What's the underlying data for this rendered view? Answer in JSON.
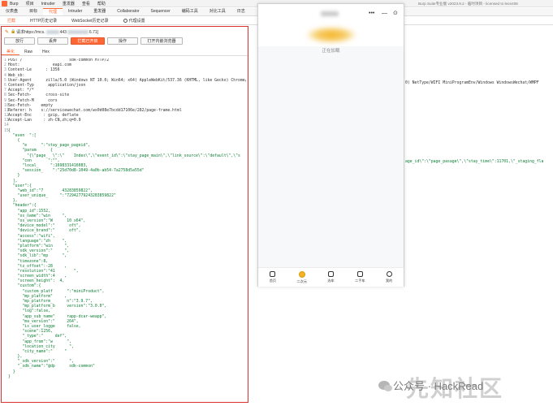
{
  "app": {
    "title": "Burp Suite专业版  v2023.9.2 - 临时项目 - licensed to leon406",
    "menu": [
      "Burp",
      "项目",
      "Intruder",
      "重发器",
      "查看",
      "帮助"
    ]
  },
  "tools": {
    "tabs": [
      "仪表盘",
      "目标",
      "代理",
      "Intruder",
      "重发器",
      "Collaborator",
      "Sequencer",
      "编码工具",
      "对比工具",
      "日志"
    ],
    "active_index": 2
  },
  "proxy_subtabs": {
    "tabs": [
      "拦截",
      "HTTP历史记录",
      "WebSocket历史记录",
      "代理设置"
    ],
    "active_index": 0
  },
  "intercept": {
    "request_prefix": "请求https://mcs.",
    "request_port": "443",
    "request_ip_tail": "6.71]",
    "buttons": [
      "放行",
      "丢弃",
      "拦截已开启",
      "操作",
      "打开内嵌浏览器"
    ],
    "primary_button_index": 2,
    "view_tabs": [
      "美化",
      "Raw",
      "Hex"
    ],
    "active_view_index": 0
  },
  "request_lines": [
    {
      "n": "1",
      "text": "POST /                    sdk-common HTTP/2"
    },
    {
      "n": "2",
      "text": "Host:              eapi.com"
    },
    {
      "n": "3",
      "text": "Content-Le      : 1356"
    },
    {
      "n": "4",
      "text": "Web_sb:"
    },
    {
      "n": "5",
      "text": "User-Agent      zilla/5.0 (Windows NT 10.0; Win64; x64) AppleWebKit/537.36 (KHTML, like Gecko) Chrome/"
    },
    {
      "n": "6",
      "text": "Content-Typ      application/json"
    },
    {
      "n": "7",
      "text": "Accept: */*"
    },
    {
      "n": "8",
      "text": "Sec-Fetch-      cross-site"
    },
    {
      "n": "9",
      "text": "Sec-Fetch-M      cors"
    },
    {
      "n": "10",
      "text": "Sec-Fetch-    empty"
    },
    {
      "n": "11",
      "text": "Referer: h    s://servicewechat.com/wx0d08e7bcdd17106e/282/page-frame.html"
    },
    {
      "n": "12",
      "text": "Accept-Enc     : gzip, deflate"
    },
    {
      "n": "13",
      "text": "Accept-Lan     : zh-CN,zh;q=0.9"
    },
    {
      "n": "14",
      "text": ""
    },
    {
      "n": "15",
      "text": "{"
    },
    {
      "n": "",
      "text": "  \"even  \":["
    },
    {
      "n": "",
      "text": "    {"
    },
    {
      "n": "",
      "text": "      \"e      \":\"stay_page_pageid\","
    },
    {
      "n": "",
      "text": "      \"param      {"
    },
    {
      "n": "",
      "text": "        \"{\\\"page_  \\\":\\\"    Index\\\",\\\"event_id\\\":\\\"stay_page_main\\\",\\\"link_source\\\":\\\"default\\\",\\\"s"
    },
    {
      "n": "",
      "text": "      \"con       \":\"\","
    },
    {
      "n": "",
      "text": "      \"local_     \":1698331416083,"
    },
    {
      "n": "",
      "text": "      \"session_    \":\"25d70d8-1049-4a0b-ab54-7a2758d5a55d\""
    },
    {
      "n": "",
      "text": "    }"
    },
    {
      "n": "",
      "text": "  ],"
    },
    {
      "n": "",
      "text": "  \"user\":{"
    },
    {
      "n": "",
      "text": "    \"web_id\":\"7        43283859822\","
    },
    {
      "n": "",
      "text": "    \"user_unique_     \":\"72942779243283859822\""
    },
    {
      "n": "",
      "text": "  },"
    },
    {
      "n": "",
      "text": "  \"header\":{"
    },
    {
      "n": "",
      "text": "    \"app_id\":1552,"
    },
    {
      "n": "",
      "text": "    \"os_name\":\"win     \","
    },
    {
      "n": "",
      "text": "    \"os_version\":\"W      10 x64\","
    },
    {
      "n": "",
      "text": "    \"device_model\":\"      oft\","
    },
    {
      "n": "",
      "text": "    \"device_brand\":\"      oft\","
    },
    {
      "n": "",
      "text": "    \"access\":\"wifi\","
    },
    {
      "n": "",
      "text": "    \"language\":\"zh     \","
    },
    {
      "n": "",
      "text": "    \"platform\":\"win     \","
    },
    {
      "n": "",
      "text": "    \"sdk_version\":\"     \","
    },
    {
      "n": "",
      "text": "    \"sdk_lib\":\"mp      \","
    },
    {
      "n": "",
      "text": "    \"timezone\":8,"
    },
    {
      "n": "",
      "text": "    \"tz_offset\":-28     ,"
    },
    {
      "n": "",
      "text": "    \"resolution\":\"41        \","
    },
    {
      "n": "",
      "text": "    \"screen_width\":4    ,"
    },
    {
      "n": "",
      "text": "    \"screen_height\":  4,"
    },
    {
      "n": "",
      "text": "    \"custom\":{"
    },
    {
      "n": "",
      "text": "      \"custom_platf      \":\"miniProduct\","
    },
    {
      "n": "",
      "text": "      \"mp_platform\"     ,"
    },
    {
      "n": "",
      "text": "      \"mp_platform_      n\":\"3.9.7\","
    },
    {
      "n": "",
      "text": "      \"mp_platform_b     version\":\"3.0.0\","
    },
    {
      "n": "",
      "text": "      \"log\":false,"
    },
    {
      "n": "",
      "text": "      \"app_sub_name\"     rapp-dcar-weapp\","
    },
    {
      "n": "",
      "text": "      \"ma_version\":\"     264\","
    },
    {
      "n": "",
      "text": "      \"is_user_logge     false,"
    },
    {
      "n": "",
      "text": "      \"scene\":1256,"
    },
    {
      "n": "",
      "text": "      \"_type\":\"     def\","
    },
    {
      "n": "",
      "text": "      \"app_from\":\"w      \","
    },
    {
      "n": "",
      "text": "      \"location_city      \","
    },
    {
      "n": "",
      "text": "      \"city_name\":\"     \""
    },
    {
      "n": "",
      "text": "    },"
    },
    {
      "n": "",
      "text": "    \"_sdk_version\":\"      \","
    },
    {
      "n": "",
      "text": "    \"_sdk_name\":\"@dp      sdk-common\""
    },
    {
      "n": "",
      "text": "  }"
    },
    {
      "n": "",
      "text": "}"
    }
  ],
  "overflow_text": {
    "ua_tail": "0) NetType/WIFI MiniProgramEnv/Windows WindowsWechat/WMPF",
    "params_tail": "age_id\\\":\\\"page_pasage\\\",\\\"stay_time\\\":11701,\\\"_staging_fla"
  },
  "mini_program": {
    "status": "正在加载",
    "tabs": [
      "首页",
      "二次元",
      "选车",
      "二手车",
      "我的"
    ],
    "active_tab_index": 1,
    "accent": "#f4b324"
  },
  "watermark": {
    "text": "公众号 · HackRead",
    "big": "先知社区"
  },
  "colors": {
    "accent": "#ff6633",
    "highlight_border": "#d9322f"
  }
}
